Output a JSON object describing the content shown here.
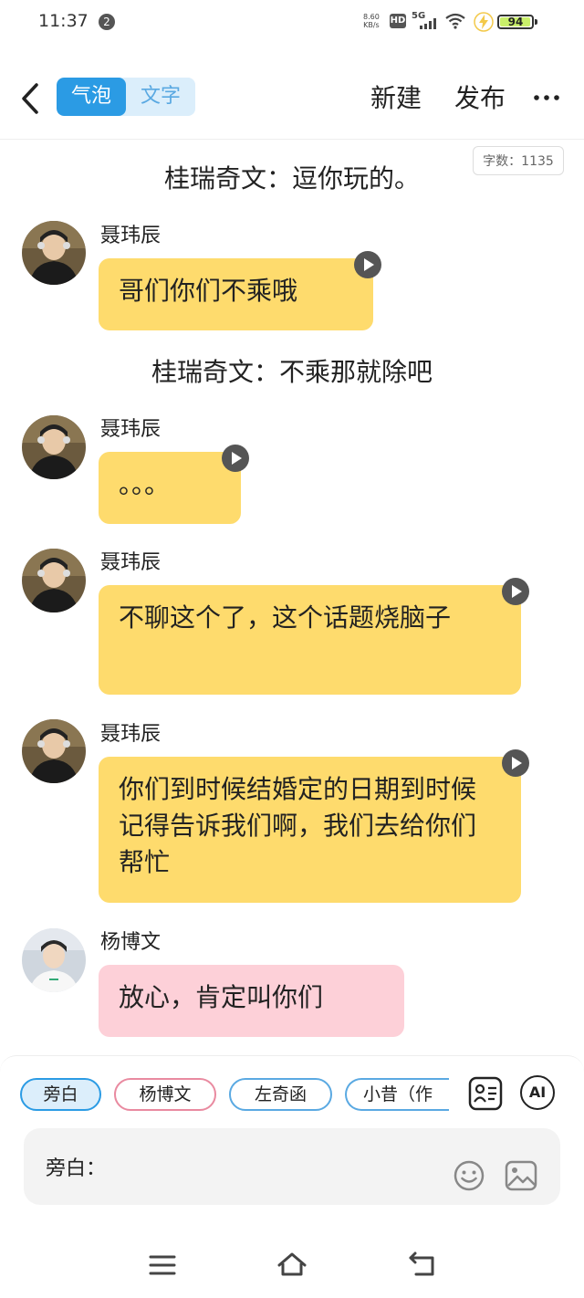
{
  "status": {
    "time": "11:37",
    "badge": "2",
    "net_speed_value": "8.60",
    "net_speed_unit": "KB/s",
    "hd": "HD",
    "network": "5G",
    "battery": "94"
  },
  "header": {
    "mode_bubble": "气泡",
    "mode_text": "文字",
    "new_label": "新建",
    "publish_label": "发布",
    "word_count": "字数：1135"
  },
  "chat": {
    "narration_1": "桂瑞奇文：逗你玩的。",
    "narration_2": "桂瑞奇文：不乘那就除吧",
    "messages": [
      {
        "speaker": "聂玮辰",
        "text": "哥们你们不乘哦"
      },
      {
        "speaker": "聂玮辰",
        "text": "。。。"
      },
      {
        "speaker": "聂玮辰",
        "text": "不聊这个了，这个话题烧脑子"
      },
      {
        "speaker": "聂玮辰",
        "text": "你们到时候结婚定的日期到时候记得告诉我们啊，我们去给你们帮忙"
      },
      {
        "speaker": "杨博文",
        "text": "放心，肯定叫你们"
      }
    ]
  },
  "composer": {
    "chips": [
      "旁白",
      "杨博文",
      "左奇函",
      "小昔（作"
    ],
    "ai_label": "AI",
    "input_label": "旁白："
  },
  "colors": {
    "accent": "#2b9be4",
    "bubble_yellow": "#fedb6d",
    "bubble_pink": "#fdd0d8"
  }
}
